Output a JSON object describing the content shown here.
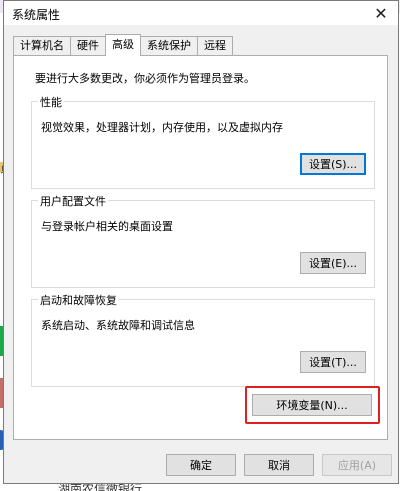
{
  "background": {
    "bottom_text": "湖南农信微银行",
    "left_text": "贞"
  },
  "window": {
    "title": "系统属性",
    "close_symbol": "✕"
  },
  "tabs": [
    {
      "label": "计算机名"
    },
    {
      "label": "硬件"
    },
    {
      "label": "高级",
      "active": true
    },
    {
      "label": "系统保护"
    },
    {
      "label": "远程"
    }
  ],
  "notice": "要进行大多数更改，你必须作为管理员登录。",
  "groups": {
    "performance": {
      "title": "性能",
      "desc": "视觉效果，处理器计划，内存使用，以及虚拟内存",
      "button": "设置(S)..."
    },
    "user_profile": {
      "title": "用户配置文件",
      "desc": "与登录帐户相关的桌面设置",
      "button": "设置(E)..."
    },
    "startup_recovery": {
      "title": "启动和故障恢复",
      "desc": "系统启动、系统故障和调试信息",
      "button": "设置(T)..."
    }
  },
  "env_button": "环境变量(N)...",
  "footer": {
    "ok": "确定",
    "cancel": "取消",
    "apply": "应用(A)"
  },
  "colors": {
    "highlight_border": "#e02020",
    "focus_border": "#0078d7"
  }
}
